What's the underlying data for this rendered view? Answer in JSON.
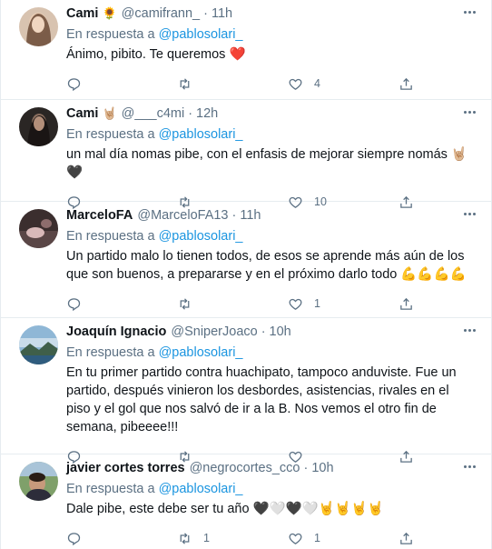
{
  "reply_prefix": "En respuesta a",
  "tweets": [
    {
      "name": "Cami",
      "name_emoji": "🌻",
      "handle": "@camifrann_",
      "time": "11h",
      "reply_to": "@pablosolari_",
      "text": "Ánimo, pibito. Te queremos ❤️",
      "likes": "4",
      "retweets": "",
      "replies": ""
    },
    {
      "name": "Cami",
      "name_emoji": "🤘🏼",
      "handle": "@___c4mi",
      "time": "12h",
      "reply_to": "@pablosolari_",
      "text": "un mal día nomas pibe, con el enfasis de mejorar siempre nomás 🤘🏼🖤",
      "likes": "10",
      "retweets": "",
      "replies": ""
    },
    {
      "name": "MarceloFA",
      "name_emoji": "",
      "handle": "@MarceloFA13",
      "time": "11h",
      "reply_to": "@pablosolari_",
      "text": "Un partido malo lo tienen todos, de esos se aprende más aún de los que son buenos, a prepararse y en el próximo darlo todo 💪💪💪💪",
      "likes": "1",
      "retweets": "",
      "replies": ""
    },
    {
      "name": "Joaquín Ignacio",
      "name_emoji": "",
      "handle": "@SniperJoaco",
      "time": "10h",
      "reply_to": "@pablosolari_",
      "text": "En tu primer partido contra huachipato, tampoco anduviste. Fue un partido, después vinieron los desbordes, asistencias, rivales en el piso y el gol que nos salvó de ir a la B. Nos vemos el otro fin de semana, pibeeee!!!",
      "likes": "",
      "retweets": "",
      "replies": ""
    },
    {
      "name": "javier cortes torres",
      "name_emoji": "",
      "handle": "@negrocortes_cco",
      "time": "10h",
      "reply_to": "@pablosolari_",
      "text": "Dale pibe, este debe ser tu año 🖤🤍🖤🤍🤘🤘🤘🤘",
      "likes": "1",
      "retweets": "1",
      "replies": ""
    }
  ],
  "colors": {
    "accent": "#1b95e0",
    "muted": "#5b7083",
    "border": "#e6ecf0"
  }
}
